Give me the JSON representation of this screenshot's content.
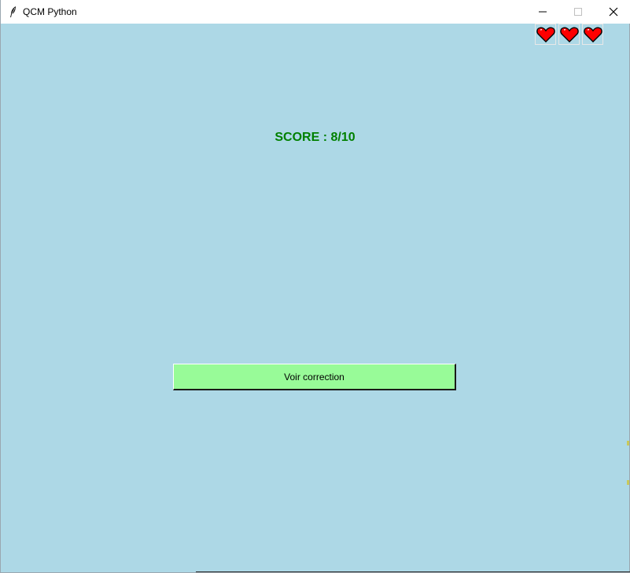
{
  "window": {
    "title": "QCM Python",
    "icon": "feather-icon",
    "controls": [
      "minimize-icon",
      "maximize-icon",
      "close-icon"
    ]
  },
  "lives": {
    "count": 3,
    "icon": "heart-icon",
    "color": "#FF0000"
  },
  "score": {
    "text": "SCORE : 8/10",
    "color": "#008000"
  },
  "correction_button": {
    "label": "Voir correction",
    "color": "#98FB98"
  },
  "background_color": "#ADD8E6"
}
